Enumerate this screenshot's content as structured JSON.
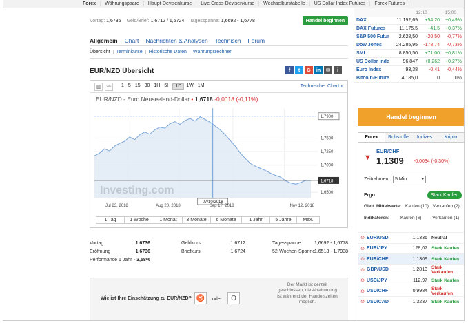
{
  "topnav": [
    "Forex",
    "Währungspaare",
    "Haupt-Devisenkurse",
    "Live Cross-Devisenkurse",
    "Wechselkurstabelle",
    "US Dollar Index Futures",
    "Forex Futures"
  ],
  "quote": {
    "vortag_label": "Vortag:",
    "vortag": "1,6736",
    "geldbrief_label": "Geld/Brief:",
    "geldbrief": "1,6712 / 1,6724",
    "spanne_label": "Tagesspanne:",
    "spanne": "1,6692 - 1,6778",
    "trade_button": "Handel beginnen"
  },
  "main_tabs": [
    "Allgemein",
    "Chart",
    "Nachrichten & Analysen",
    "Technisch",
    "Forum"
  ],
  "sub_tabs": [
    "Übersicht",
    "Terminkurse",
    "Historische Daten",
    "Währungsrechner"
  ],
  "page_title": "EUR/NZD Übersicht",
  "share_icons": [
    {
      "icon": "facebook-icon",
      "glyph": "f",
      "color": "#3b5998"
    },
    {
      "icon": "twitter-icon",
      "glyph": "t",
      "color": "#1da1f2"
    },
    {
      "icon": "google-plus-icon",
      "glyph": "G",
      "color": "#dd4b39"
    },
    {
      "icon": "linkedin-icon",
      "glyph": "in",
      "color": "#0077b5"
    },
    {
      "icon": "email-icon",
      "glyph": "✉",
      "color": "#555555"
    },
    {
      "icon": "info-icon",
      "glyph": "i",
      "color": "#555555"
    }
  ],
  "chart_toolbar": {
    "intervals": [
      "1",
      "5",
      "15",
      "30",
      "1H",
      "5H",
      "1D",
      "1W",
      "1M"
    ],
    "selected": "1D",
    "tech_link": "Technischer Chart »"
  },
  "chart_heading": {
    "name": "EUR/NZD - Euro Neuseeland-Dollar",
    "price": "1,6718",
    "change": "-0,0018",
    "pct": "(-0,11%)"
  },
  "chart_data": {
    "type": "area",
    "watermark": "Investing.com",
    "x_ticks": [
      "Jul 23, 2018",
      "Aug 20, 2018",
      "Sep 17, 2018",
      "Nov 12, 2018"
    ],
    "y_ticks": [
      "1,7900",
      "1,7500",
      "1,7250",
      "1,7000",
      "1,6718",
      "1,6500"
    ],
    "ylim": [
      1.64,
      1.805
    ],
    "crosshair_label": "07/10/2018",
    "crosshair_value": "1,7900",
    "last_value": "1,6718",
    "values": [
      1.717,
      1.722,
      1.73,
      1.726,
      1.735,
      1.74,
      1.744,
      1.752,
      1.747,
      1.756,
      1.761,
      1.757,
      1.765,
      1.77,
      1.768,
      1.776,
      1.78,
      1.775,
      1.782,
      1.786,
      1.781,
      1.789,
      1.784,
      1.779,
      1.772,
      1.765,
      1.756,
      1.745,
      1.735,
      1.722,
      1.712,
      1.703,
      1.698,
      1.694,
      1.69,
      1.685,
      1.681,
      1.678,
      1.671,
      1.667,
      1.665,
      1.668,
      1.672,
      1.6718
    ]
  },
  "periods": [
    "1 Tag",
    "1 Woche",
    "1 Monat",
    "3 Monate",
    "6 Monate",
    "1 Jahr",
    "5 Jahre",
    "Max."
  ],
  "stats": [
    [
      {
        "l": "Vortag",
        "v": "1,6736"
      },
      {
        "l": "Geldkurs",
        "v": "1,6712"
      },
      {
        "l": "Tagesspanne",
        "v": "1,6692 - 1,6778"
      }
    ],
    [
      {
        "l": "Eröffnung",
        "v": "1,6736"
      },
      {
        "l": "Briefkurs",
        "v": "1,6724"
      },
      {
        "l": "52-Wochen-Spanne",
        "v": "1,6518 - 1,7938"
      }
    ],
    [
      {
        "l": "Performance 1 Jahr",
        "v": "- 3,58%"
      }
    ]
  ],
  "vote": {
    "question": "Wie ist Ihre Einschätzung zu EUR/NZD?",
    "or": "oder",
    "note": "Der Markt ist derzeit geschlossen, die Abstimmung ist während der Handelszeiten möglich."
  },
  "tickers": {
    "times": [
      "12:10",
      "15:00"
    ],
    "rows": [
      {
        "n": "DAX",
        "p": "11.192,69",
        "c": "+54,20",
        "pc": "+0,49%",
        "dir": "up"
      },
      {
        "n": "DAX Futures",
        "p": "11.175,5",
        "c": "+41,5",
        "pc": "+0,37%",
        "dir": "up"
      },
      {
        "n": "S&P 500 Futures",
        "p": "2.628,50",
        "c": "-20,50",
        "pc": "-0,77%",
        "dir": "down"
      },
      {
        "n": "Dow Jones",
        "p": "24.285,95",
        "c": "-178,74",
        "pc": "-0,73%",
        "dir": "down"
      },
      {
        "n": "SMI",
        "p": "8.850,50",
        "c": "+71,00",
        "pc": "+0,81%",
        "dir": "up"
      },
      {
        "n": "US Dollar Index",
        "p": "96,847",
        "c": "+0,262",
        "pc": "+0,27%",
        "dir": "up"
      },
      {
        "n": "Euro Index",
        "p": "93,38",
        "c": "-0,41",
        "pc": "-0,44%",
        "dir": "down"
      },
      {
        "n": "Bitcoin-Futures",
        "p": "4.185,0",
        "c": "0",
        "pc": "0%",
        "dir": "neutral"
      }
    ]
  },
  "big_trade_button": "Handel beginnen",
  "widget": {
    "tabs": [
      "Forex",
      "Rohstoffe",
      "Indizes",
      "Kripto"
    ],
    "pair": "EUR/CHF",
    "price": "1,1309",
    "change": "-0,0034 (-0,30%)",
    "timeframe_label": "Zeitrahmen",
    "timeframe_value": "5 Min",
    "ergo_label": "Ergo",
    "ergo_badge": "Stark Kaufen",
    "ma_label": "Gleit. Mittelwerte:",
    "ma_buy": "Kaufen (10)",
    "ma_sell": "Verkaufen (2)",
    "ind_label": "Indikatoren:",
    "ind_buy": "Kaufen (6)",
    "ind_sell": "Verkaufen (1)",
    "list": [
      {
        "n": "EUR/USD",
        "p": "1,1336",
        "s": "Neutral",
        "cls": "neutral"
      },
      {
        "n": "EUR/JPY",
        "p": "128,07",
        "s": "Stark Kaufen",
        "cls": "up"
      },
      {
        "n": "EUR/CHF",
        "p": "1,1309",
        "s": "Stark Kaufen",
        "cls": "up"
      },
      {
        "n": "GBP/USD",
        "p": "1,2813",
        "s": "Stark Verkaufen",
        "cls": "down"
      },
      {
        "n": "USD/JPY",
        "p": "112,97",
        "s": "Stark Kaufen",
        "cls": "up"
      },
      {
        "n": "USD/CHF",
        "p": "0,9984",
        "s": "Stark Verkaufen",
        "cls": "down"
      },
      {
        "n": "USD/CAD",
        "p": "1,3237",
        "s": "Stark Kaufen",
        "cls": "up"
      }
    ]
  }
}
